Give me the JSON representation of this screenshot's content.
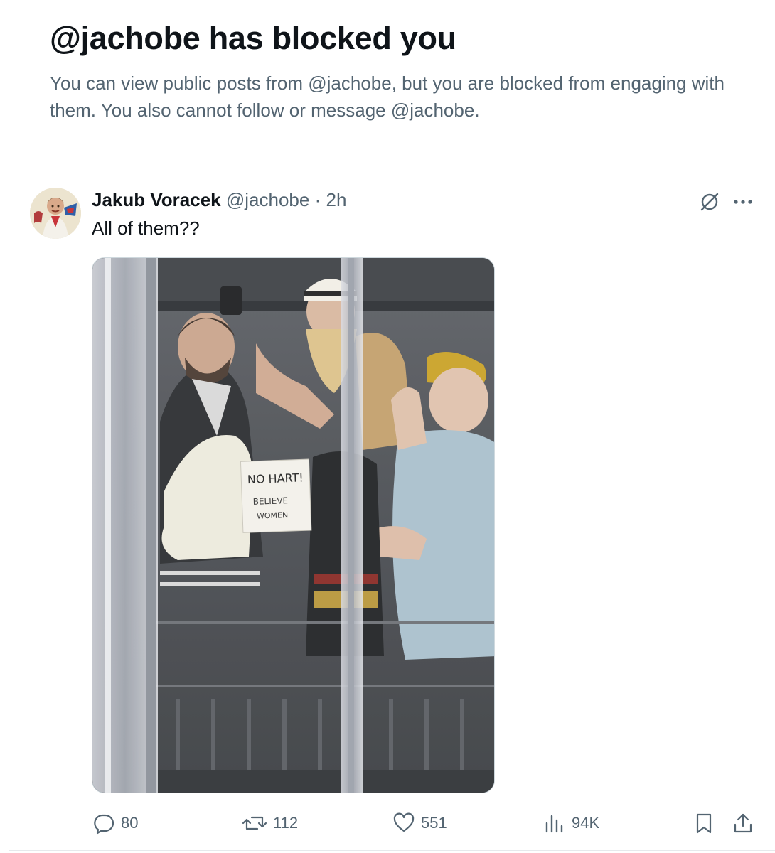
{
  "block_banner": {
    "title": "@jachobe has blocked you",
    "description": "You can view public posts from @jachobe, but you are blocked from engaging with them. You also cannot follow or message @jachobe."
  },
  "post": {
    "author_name": "Jakub Voracek",
    "author_handle": "@jachobe",
    "separator": "·",
    "time": "2h",
    "text": "All of them??",
    "image": {
      "sign_line1": "NO HART!",
      "sign_line2": "BELIEVE",
      "sign_line3": "WOMEN"
    },
    "stats": {
      "replies": "80",
      "reposts": "112",
      "likes": "551",
      "views": "94K"
    }
  },
  "icons": {
    "reply": "reply-bubble-icon",
    "repost": "repost-icon",
    "like": "heart-icon",
    "views": "analytics-bars-icon",
    "bookmark": "bookmark-icon",
    "share": "share-icon",
    "grok": "grok-icon",
    "more": "more-dots-icon"
  },
  "colors": {
    "text_primary": "#0f1419",
    "text_muted": "#536471",
    "divider": "#e6e9ec"
  }
}
